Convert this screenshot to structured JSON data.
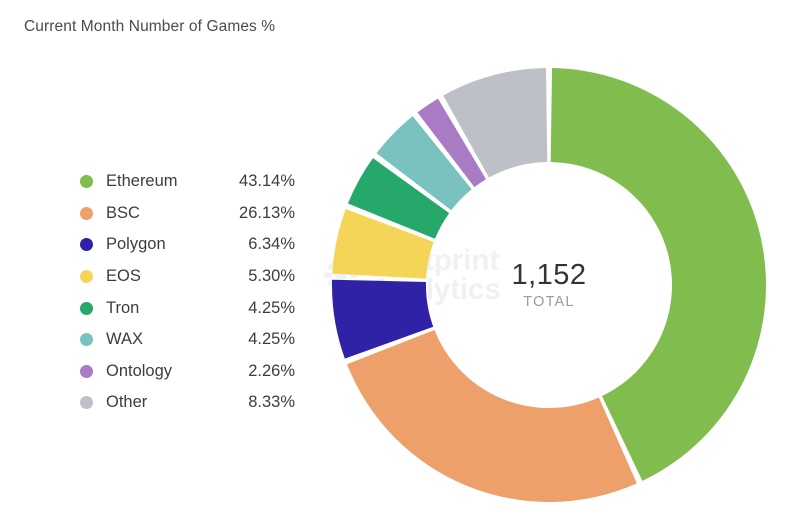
{
  "chart_title": "Current Month Number of Games %",
  "center": {
    "value": "1,152",
    "caption": "TOTAL"
  },
  "watermark": {
    "line1": "Footprint",
    "line2": "Analytics",
    "mark_icon": "flower-logo-icon"
  },
  "legend": {
    "items": [
      {
        "label": "Ethereum",
        "value": "43.14%",
        "color": "#80bc4e"
      },
      {
        "label": "BSC",
        "value": "26.13%",
        "color": "#eda06a"
      },
      {
        "label": "Polygon",
        "value": "6.34%",
        "color": "#2f22a6"
      },
      {
        "label": "EOS",
        "value": "5.30%",
        "color": "#f5d558"
      },
      {
        "label": "Tron",
        "value": "4.25%",
        "color": "#25a86a"
      },
      {
        "label": "WAX",
        "value": "4.25%",
        "color": "#79c2c0"
      },
      {
        "label": "Ontology",
        "value": "2.26%",
        "color": "#a87bc4"
      },
      {
        "label": "Other",
        "value": "8.33%",
        "color": "#bdc0c6"
      }
    ]
  },
  "chart_data": {
    "type": "pie",
    "variant": "donut",
    "title": "Current Month Number of Games %",
    "unit": "%",
    "total": 1152,
    "total_label": "TOTAL",
    "start_angle_deg": 0,
    "direction": "clockwise",
    "inner_radius_ratio": 0.567,
    "gap_deg": 1.6,
    "legend_position": "left",
    "labels": [
      "Ethereum",
      "BSC",
      "Polygon",
      "EOS",
      "Tron",
      "WAX",
      "Ontology",
      "Other"
    ],
    "values": [
      43.14,
      26.13,
      6.34,
      5.3,
      4.25,
      4.25,
      2.26,
      8.33
    ],
    "colors": [
      "#80bc4e",
      "#eda06a",
      "#2f22a6",
      "#f5d558",
      "#25a86a",
      "#79c2c0",
      "#a87bc4",
      "#bdc0c6"
    ],
    "slices": [
      {
        "label": "Ethereum",
        "value": 43.14,
        "display": "43.14%",
        "color": "#80bc4e"
      },
      {
        "label": "BSC",
        "value": 26.13,
        "display": "26.13%",
        "color": "#eda06a"
      },
      {
        "label": "Polygon",
        "value": 6.34,
        "display": "6.34%",
        "color": "#2f22a6"
      },
      {
        "label": "EOS",
        "value": 5.3,
        "display": "5.30%",
        "color": "#f5d558"
      },
      {
        "label": "Tron",
        "value": 4.25,
        "display": "4.25%",
        "color": "#25a86a"
      },
      {
        "label": "WAX",
        "value": 4.25,
        "display": "4.25%",
        "color": "#79c2c0"
      },
      {
        "label": "Ontology",
        "value": 2.26,
        "display": "2.26%",
        "color": "#a87bc4"
      },
      {
        "label": "Other",
        "value": 8.33,
        "display": "8.33%",
        "color": "#bdc0c6"
      }
    ]
  }
}
